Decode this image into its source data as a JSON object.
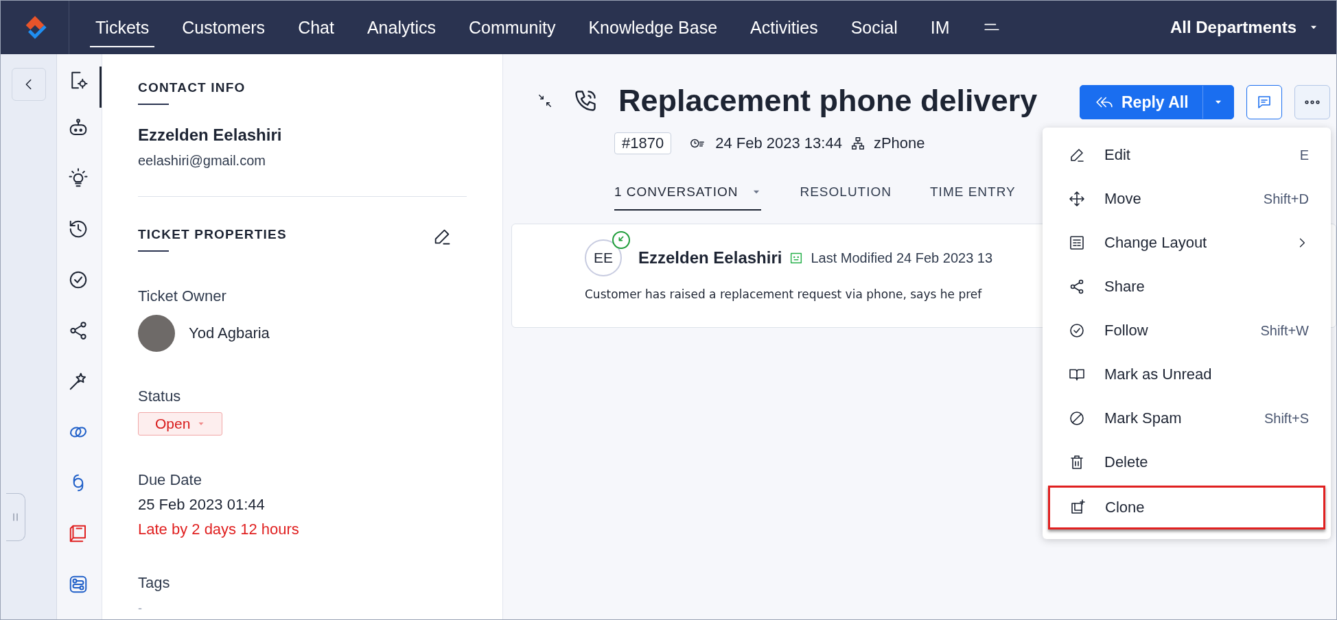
{
  "nav": {
    "tabs": [
      {
        "label": "Tickets",
        "selected": true
      },
      {
        "label": "Customers",
        "selected": false
      },
      {
        "label": "Chat",
        "selected": false
      },
      {
        "label": "Analytics",
        "selected": false
      },
      {
        "label": "Community",
        "selected": false
      },
      {
        "label": "Knowledge Base",
        "selected": false
      },
      {
        "label": "Activities",
        "selected": false
      },
      {
        "label": "Social",
        "selected": false
      },
      {
        "label": "IM",
        "selected": false
      }
    ],
    "department": "All Departments"
  },
  "side_tools": [
    {
      "kind": "settings",
      "selected": true
    },
    {
      "kind": "bot",
      "selected": false
    },
    {
      "kind": "idea",
      "selected": false
    },
    {
      "kind": "history",
      "selected": false
    },
    {
      "kind": "check",
      "selected": false
    },
    {
      "kind": "share",
      "selected": false
    },
    {
      "kind": "magic",
      "selected": false
    },
    {
      "kind": "link",
      "selected": false,
      "color": "#1f5fc8"
    },
    {
      "kind": "ring",
      "selected": false,
      "color": "#1f5fc8"
    },
    {
      "kind": "book",
      "selected": false,
      "color": "#e02020"
    },
    {
      "kind": "flow",
      "selected": false,
      "color": "#1f5fc8"
    }
  ],
  "contact": {
    "heading": "CONTACT INFO",
    "name": "Ezzelden Eelashiri",
    "email": "eelashiri@gmail.com"
  },
  "properties": {
    "heading": "TICKET PROPERTIES",
    "owner_label": "Ticket Owner",
    "owner_name": "Yod Agbaria",
    "status_label": "Status",
    "status": "Open",
    "due_label": "Due Date",
    "due_value": "25 Feb 2023 01:44",
    "due_note": "Late by 2 days 12 hours",
    "tags_label": "Tags",
    "tags_value": "-"
  },
  "ticket": {
    "title": "Replacement phone delivery",
    "number": "#1870",
    "created": "24 Feb 2023 13:44",
    "department": "zPhone",
    "tabs": [
      {
        "label": "1 CONVERSATION",
        "selected": true
      },
      {
        "label": "RESOLUTION",
        "selected": false
      },
      {
        "label": "TIME ENTRY",
        "selected": false
      }
    ],
    "reply_button": "Reply All",
    "conversation": {
      "initials": "EE",
      "author": "Ezzelden Eelashiri",
      "meta": "Last Modified 24 Feb 2023 13",
      "body": "Customer has raised a replacement request via phone, says he pref"
    }
  },
  "menu": [
    {
      "kind": "edit",
      "label": "Edit",
      "shortcut": "E",
      "submenu": false,
      "highlighted": false
    },
    {
      "kind": "move",
      "label": "Move",
      "shortcut": "Shift+D",
      "submenu": false,
      "highlighted": false
    },
    {
      "kind": "layout",
      "label": "Change Layout",
      "submenu": true,
      "highlighted": false
    },
    {
      "kind": "share",
      "label": "Share",
      "submenu": false,
      "highlighted": false
    },
    {
      "kind": "follow",
      "label": "Follow",
      "shortcut": "Shift+W",
      "submenu": false,
      "highlighted": false
    },
    {
      "kind": "unread",
      "label": "Mark as Unread",
      "submenu": false,
      "highlighted": false
    },
    {
      "kind": "spam",
      "label": "Mark Spam",
      "shortcut": "Shift+S",
      "submenu": false,
      "highlighted": false
    },
    {
      "kind": "delete",
      "label": "Delete",
      "submenu": false,
      "highlighted": false
    },
    {
      "kind": "clone",
      "label": "Clone",
      "submenu": false,
      "highlighted": true
    }
  ]
}
